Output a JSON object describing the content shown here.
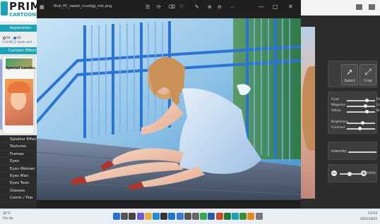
{
  "left_app": {
    "logo_main": "PRIMA",
    "logo_sub": "CARTOONIZER",
    "register_label": "Registration",
    "radio_options": [
      "SD",
      "HD"
    ],
    "full_hd_link": "Full HD (1 week com...",
    "cartoon_effects_label": "Cartoon Effects",
    "thumb_label": "Special Landsc...",
    "effects_menu": [
      "Splatter Effect",
      "Textures",
      "Frames",
      "Eyes",
      "Eyes Woman",
      "Eyes Man",
      "Eyes Toon",
      "Glasses",
      "Comic / Pop"
    ]
  },
  "viewer": {
    "file_name": "final_PC_sweet_ccszlajg_mlx.png",
    "toolbar_icons": [
      "open-file-icon",
      "rotate-icon",
      "delete-icon",
      "favorite-icon",
      "edit-icon",
      "zoom-in-icon",
      "zoom-out-icon",
      "more-icon"
    ],
    "window_controls": [
      "minimize",
      "maximize",
      "close"
    ]
  },
  "right_app": {
    "select_label": "Select",
    "crop_label": "Crop",
    "color_sliders": [
      {
        "left": "Cyan",
        "right": "Re",
        "level": 0.7
      },
      {
        "left": "Magenta",
        "right": "Gr",
        "level": 0.65
      },
      {
        "left": "Yellow",
        "right": "Bl",
        "level": 0.7
      }
    ],
    "tone_sliders": [
      {
        "left": "Brightness",
        "level": 0.55
      },
      {
        "left": "Contrast",
        "level": 0.45
      }
    ],
    "intensity_label": "Intensity",
    "zoom_percent": "100%",
    "zoom_level": 0.45
  },
  "taskbar": {
    "temperature": "32°C",
    "weather": "Clo-dy",
    "time": "13:03",
    "date": "2022/10/21",
    "apps": [
      "start-icon",
      "search-icon",
      "task-view-icon",
      "chat-icon",
      "file-explorer-icon",
      "edge-icon",
      "store-icon",
      "mail-icon",
      "photos-icon",
      "camera-icon",
      "settings-icon",
      "chrome-icon",
      "word-icon",
      "powerpoint-icon",
      "excel-icon",
      "prima-app-icon",
      "games-icon",
      "vlc-icon",
      "tool-icon"
    ]
  },
  "colors": {
    "brand_teal": "#1aa3b6",
    "dark_panel": "#2d2d2d",
    "viewer_bg": "#202020"
  }
}
